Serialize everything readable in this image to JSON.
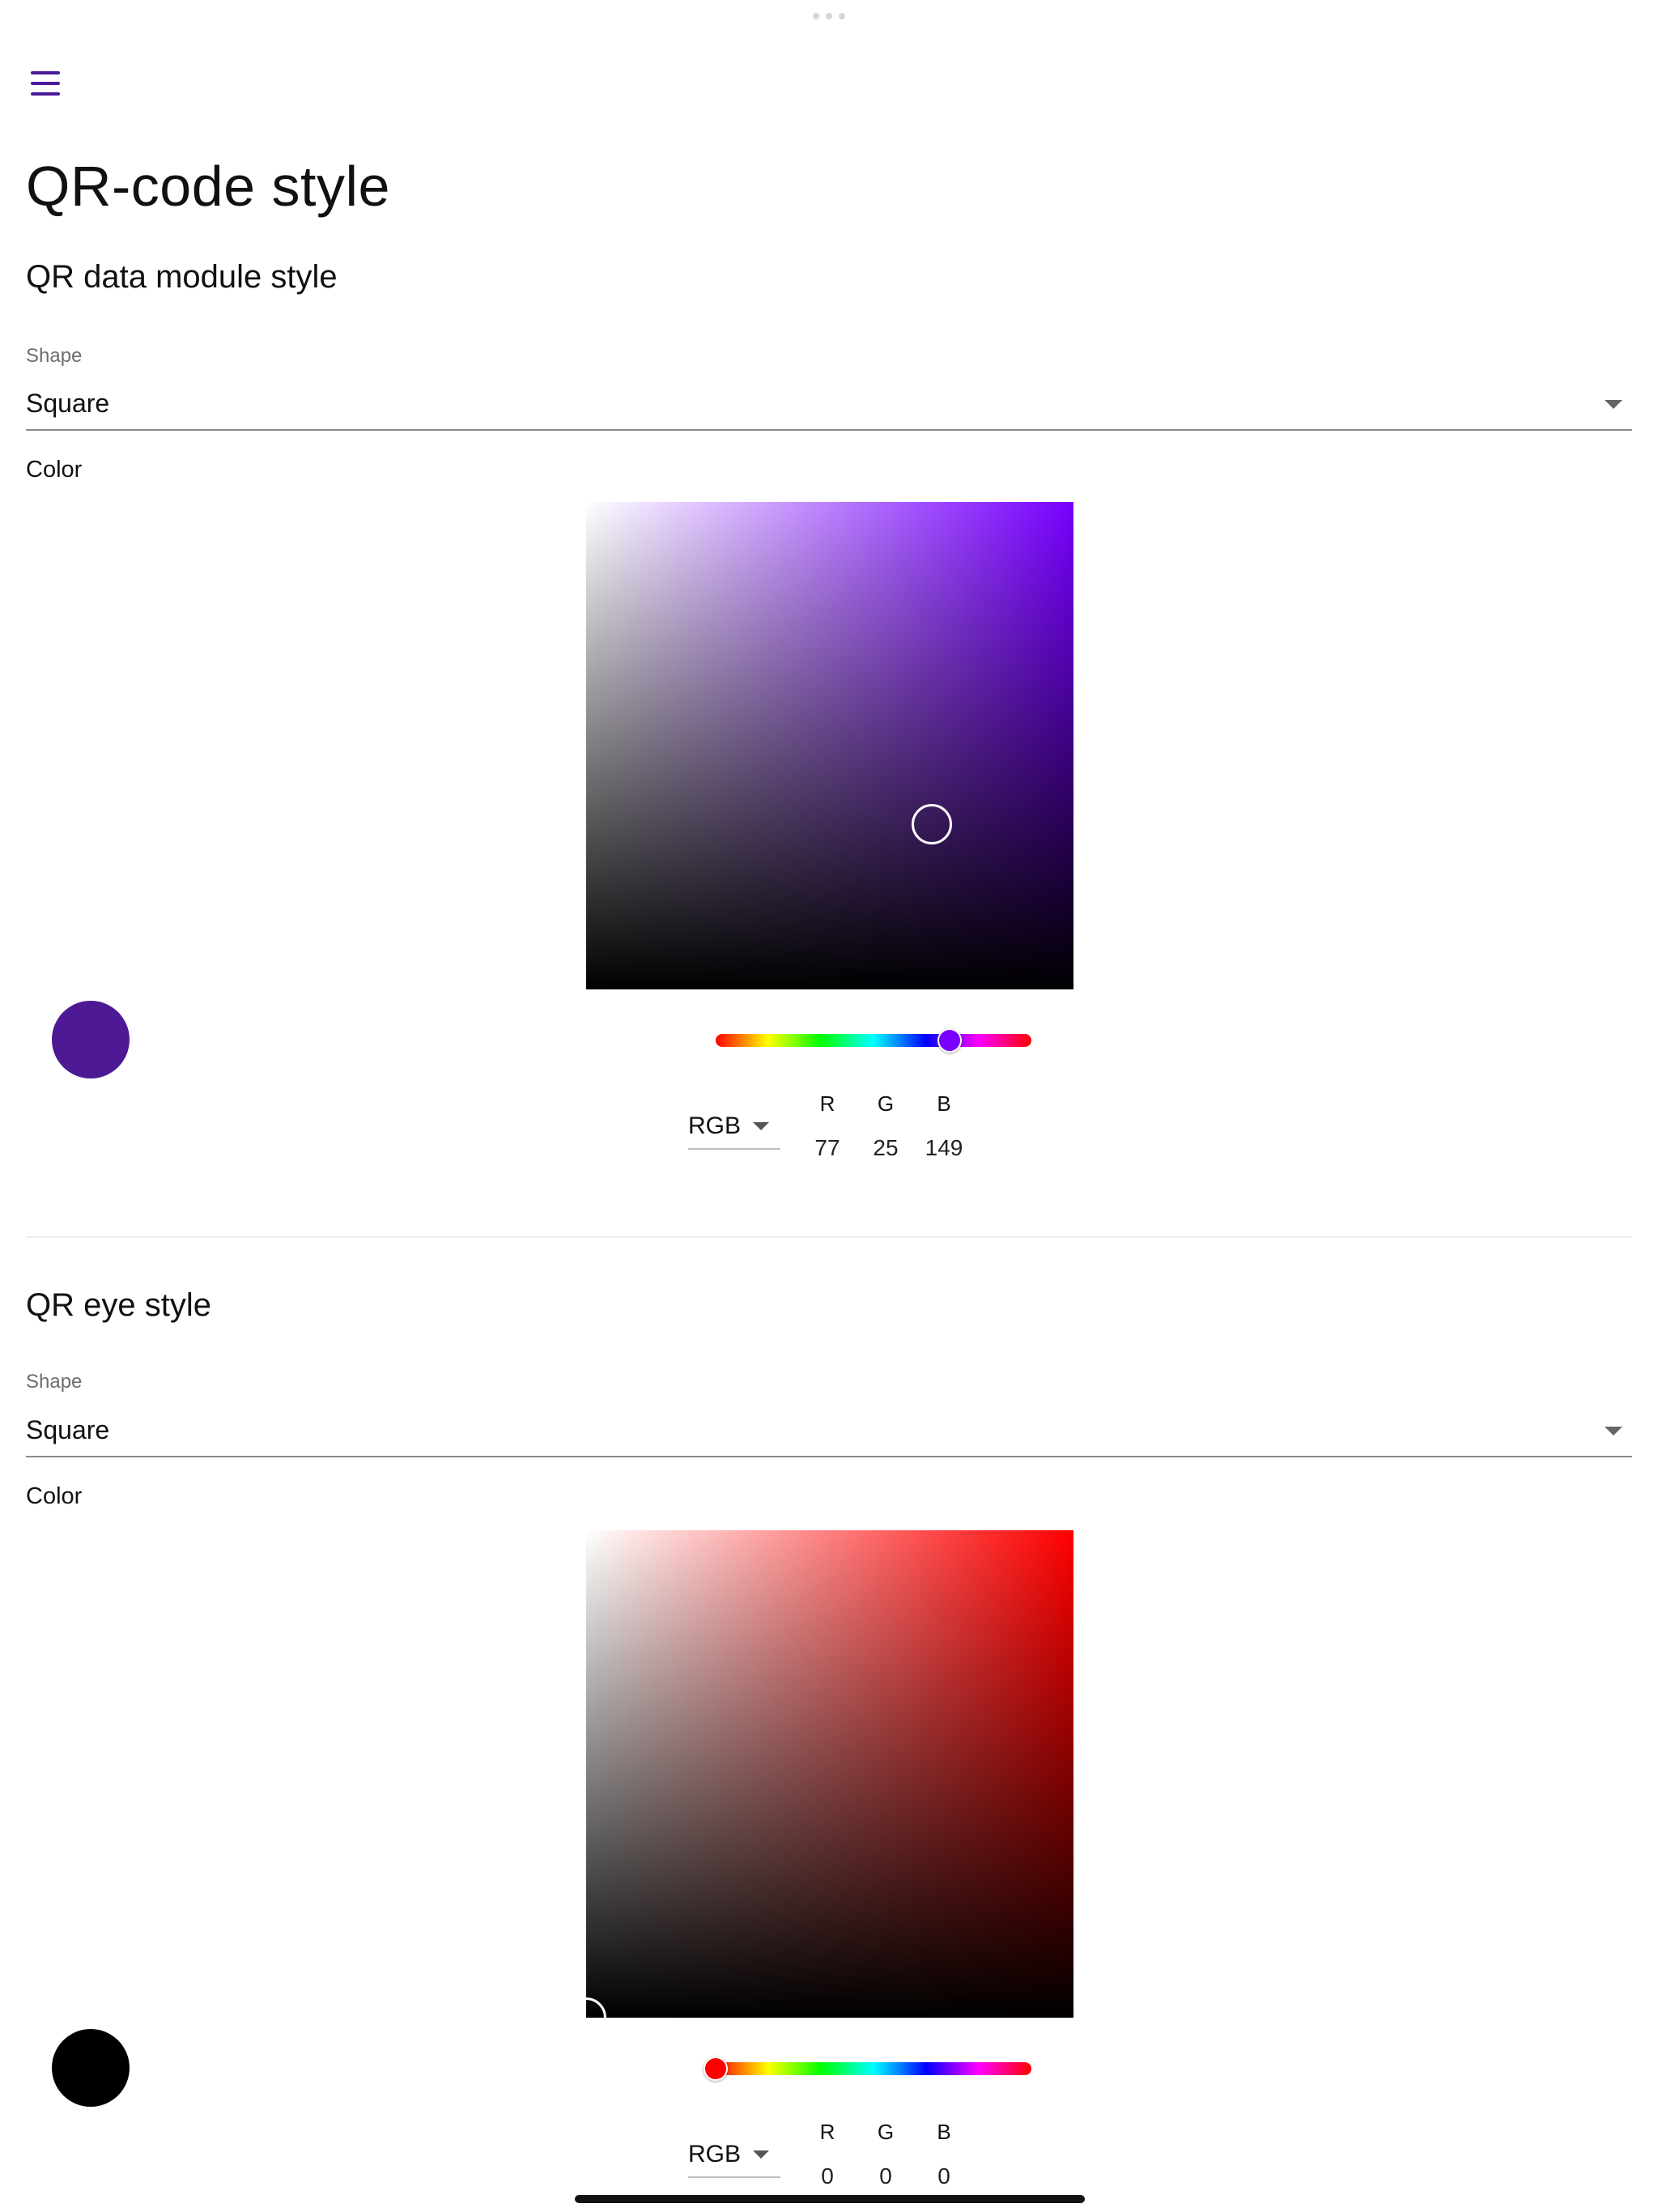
{
  "page": {
    "title": "QR-code style"
  },
  "menu": {
    "icon": "hamburger-menu-icon",
    "color": "#4a1a9c"
  },
  "data_module": {
    "section_title": "QR data module style",
    "shape_label": "Shape",
    "shape_value": "Square",
    "color_label": "Color",
    "hue_color": "#7700ff",
    "hue_fraction": 0.74,
    "swatch_color": "#4d1995",
    "mode": "RGB",
    "channels": {
      "r_label": "R",
      "g_label": "G",
      "b_label": "B",
      "r": "77",
      "g": "25",
      "b": "149"
    }
  },
  "eye": {
    "section_title": "QR eye style",
    "shape_label": "Shape",
    "shape_value": "Square",
    "color_label": "Color",
    "hue_color": "#ff0000",
    "hue_fraction": 0.0,
    "swatch_color": "#000000",
    "mode": "RGB",
    "channels": {
      "r_label": "R",
      "g_label": "G",
      "b_label": "B",
      "r": "0",
      "g": "0",
      "b": "0"
    }
  }
}
